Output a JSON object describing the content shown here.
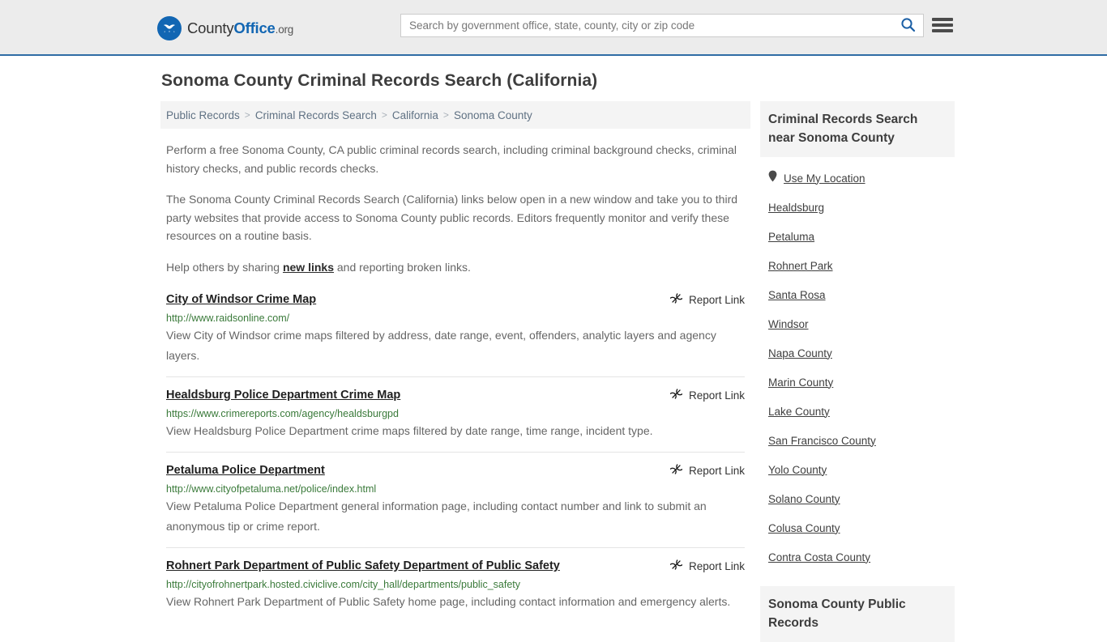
{
  "header": {
    "brand": {
      "logo_icon": "eagle-stars-seal-icon",
      "name_part1": "County",
      "name_part2": "Office",
      "name_part3": ".org"
    },
    "search": {
      "placeholder": "Search by government office, state, county, city or zip code",
      "value": "",
      "search_icon": "search-icon"
    },
    "menu_icon": "hamburger-menu-icon",
    "accent_color": "#2f6ca5",
    "background_color": "#ececec"
  },
  "page": {
    "title": "Sonoma County Criminal Records Search (California)"
  },
  "breadcrumb": {
    "separator": ">",
    "items": [
      {
        "label": "Public Records"
      },
      {
        "label": "Criminal Records Search"
      },
      {
        "label": "California"
      },
      {
        "label": "Sonoma County"
      }
    ]
  },
  "intro": {
    "paragraph1": "Perform a free Sonoma County, CA public criminal records search, including criminal background checks, criminal history checks, and public records checks.",
    "paragraph2": "The Sonoma County Criminal Records Search (California) links below open in a new window and take you to third party websites that provide access to Sonoma County public records. Editors frequently monitor and verify these resources on a routine basis.",
    "paragraph3_before": "Help others by sharing ",
    "paragraph3_link": "new links",
    "paragraph3_after": " and reporting broken links."
  },
  "listings": {
    "report_label": "Report Link",
    "report_icon": "broken-link-icon",
    "items": [
      {
        "title": "City of Windsor Crime Map",
        "url": "http://www.raidsonline.com/",
        "description": "View City of Windsor crime maps filtered by address, date range, event, offenders, analytic layers and agency layers."
      },
      {
        "title": "Healdsburg Police Department Crime Map",
        "url": "https://www.crimereports.com/agency/healdsburgpd",
        "description": "View Healdsburg Police Department crime maps filtered by date range, time range, incident type."
      },
      {
        "title": "Petaluma Police Department",
        "url": "http://www.cityofpetaluma.net/police/index.html",
        "description": "View Petaluma Police Department general information page, including contact number and link to submit an anonymous tip or crime report."
      },
      {
        "title": "Rohnert Park Department of Public Safety Department of Public Safety",
        "url": "http://cityofrohnertpark.hosted.civiclive.com/city_hall/departments/public_safety",
        "description": "View Rohnert Park Department of Public Safety home page, including contact information and emergency alerts."
      }
    ]
  },
  "sidebar": {
    "nearby_heading": "Criminal Records Search near Sonoma County",
    "use_my_location": "Use My Location",
    "location_icon": "map-pin-icon",
    "links": [
      {
        "label": "Healdsburg"
      },
      {
        "label": "Petaluma"
      },
      {
        "label": "Rohnert Park"
      },
      {
        "label": "Santa Rosa"
      },
      {
        "label": "Windsor"
      },
      {
        "label": "Napa County"
      },
      {
        "label": "Marin County"
      },
      {
        "label": "Lake County"
      },
      {
        "label": "San Francisco County"
      },
      {
        "label": "Yolo County"
      },
      {
        "label": "Solano County"
      },
      {
        "label": "Colusa County"
      },
      {
        "label": "Contra Costa County"
      }
    ],
    "public_records_heading": "Sonoma County Public Records"
  }
}
